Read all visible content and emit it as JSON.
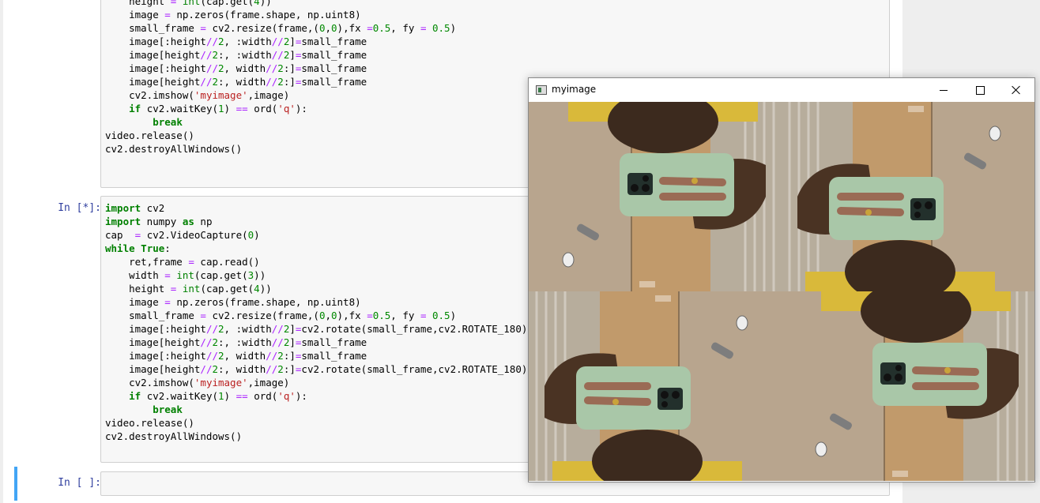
{
  "cells": [
    {
      "prompt": "",
      "lines": [
        "    height = int(cap.get(4))",
        "    image = np.zeros(frame.shape, np.uint8)",
        "    small_frame = cv2.resize(frame,(0,0),fx =0.5, fy = 0.5)",
        "    image[:height//2, :width//2]=small_frame",
        "    image[height//2:, :width//2]=small_frame",
        "    image[:height//2, width//2:]=small_frame",
        "    image[height//2:, width//2:]=small_frame",
        "    cv2.imshow('myimage',image)",
        "    if cv2.waitKey(1) == ord('q'):",
        "        break",
        "video.release()",
        "cv2.destroyAllWindows()"
      ]
    },
    {
      "prompt": "In [*]:",
      "lines": [
        "import cv2",
        "import numpy as np",
        "cap  = cv2.VideoCapture(0)",
        "while True:",
        "    ret,frame = cap.read()",
        "    width = int(cap.get(3))",
        "    height = int(cap.get(4))",
        "    image = np.zeros(frame.shape, np.uint8)",
        "    small_frame = cv2.resize(frame,(0,0),fx =0.5, fy = 0.5)",
        "    image[:height//2, :width//2]=cv2.rotate(small_frame,cv2.ROTATE_180)",
        "    image[height//2:, :width//2]=small_frame",
        "    image[:height//2, width//2:]=small_frame",
        "    image[height//2:, width//2:]=cv2.rotate(small_frame,cv2.ROTATE_180)",
        "    cv2.imshow('myimage',image)",
        "    if cv2.waitKey(1) == ord('q'):",
        "        break",
        "video.release()",
        "cv2.destroyAllWindows()"
      ]
    },
    {
      "prompt": "In [ ]:",
      "lines": []
    }
  ],
  "window": {
    "title": "myimage",
    "quadrants": [
      {
        "position": "top-left",
        "rotated": true
      },
      {
        "position": "top-right",
        "rotated": false
      },
      {
        "position": "bottom-left",
        "rotated": false
      },
      {
        "position": "bottom-right",
        "rotated": true
      }
    ]
  },
  "icons": {
    "minimize": "minimize-icon",
    "maximize": "maximize-icon",
    "close": "close-icon",
    "app": "app-icon"
  },
  "colors": {
    "prompt": "#303f9f",
    "keyword": "#008000",
    "operator": "#aa22ff",
    "string": "#ba2121",
    "selected_cell": "#42a5f5"
  }
}
